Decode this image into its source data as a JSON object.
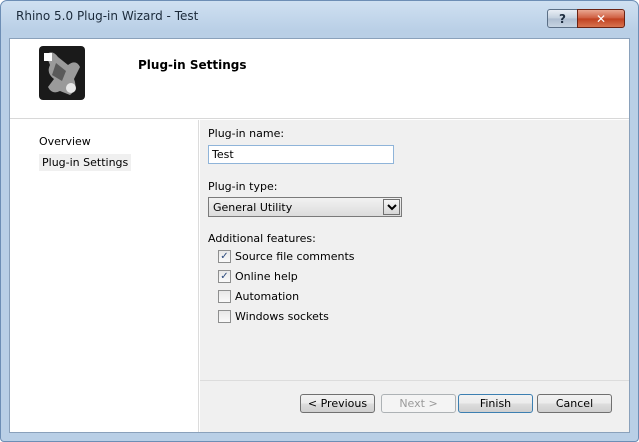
{
  "window": {
    "title": "Rhino 5.0 Plug-in Wizard - Test"
  },
  "title_buttons": {
    "help": "?",
    "close": "✕"
  },
  "header": {
    "title": "Plug-in Settings",
    "logo_icon": "rhino-logo-icon"
  },
  "nav": {
    "items": [
      "Overview",
      "Plug-in Settings"
    ],
    "active_index": 1
  },
  "form": {
    "name_label": "Plug-in name:",
    "name_value": "Test",
    "type_label": "Plug-in type:",
    "type_value": "General Utility",
    "features_label": "Additional features:",
    "features": [
      {
        "label": "Source file comments",
        "checked": true
      },
      {
        "label": "Online help",
        "checked": true
      },
      {
        "label": "Automation",
        "checked": false
      },
      {
        "label": "Windows sockets",
        "checked": false
      }
    ]
  },
  "buttons": {
    "previous": "< Previous",
    "next": "Next >",
    "finish": "Finish",
    "cancel": "Cancel"
  }
}
